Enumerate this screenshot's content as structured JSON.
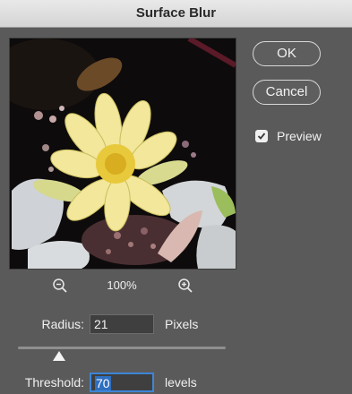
{
  "dialog": {
    "title": "Surface Blur"
  },
  "buttons": {
    "ok_label": "OK",
    "cancel_label": "Cancel"
  },
  "preview_option": {
    "label": "Preview",
    "checked": true
  },
  "zoom": {
    "level": "100%",
    "zoom_out_icon": "zoom-out-icon",
    "zoom_in_icon": "zoom-in-icon"
  },
  "radius": {
    "label": "Radius:",
    "value": "21",
    "unit": "Pixels",
    "slider_fraction": 0.2
  },
  "threshold": {
    "label": "Threshold:",
    "value": "70",
    "unit": "levels"
  },
  "colors": {
    "dialog_bg": "#5a5a5a",
    "titlebar_bg": "#dcdcdc",
    "selection": "#2f6fc0",
    "lily": "#f2e79a"
  }
}
